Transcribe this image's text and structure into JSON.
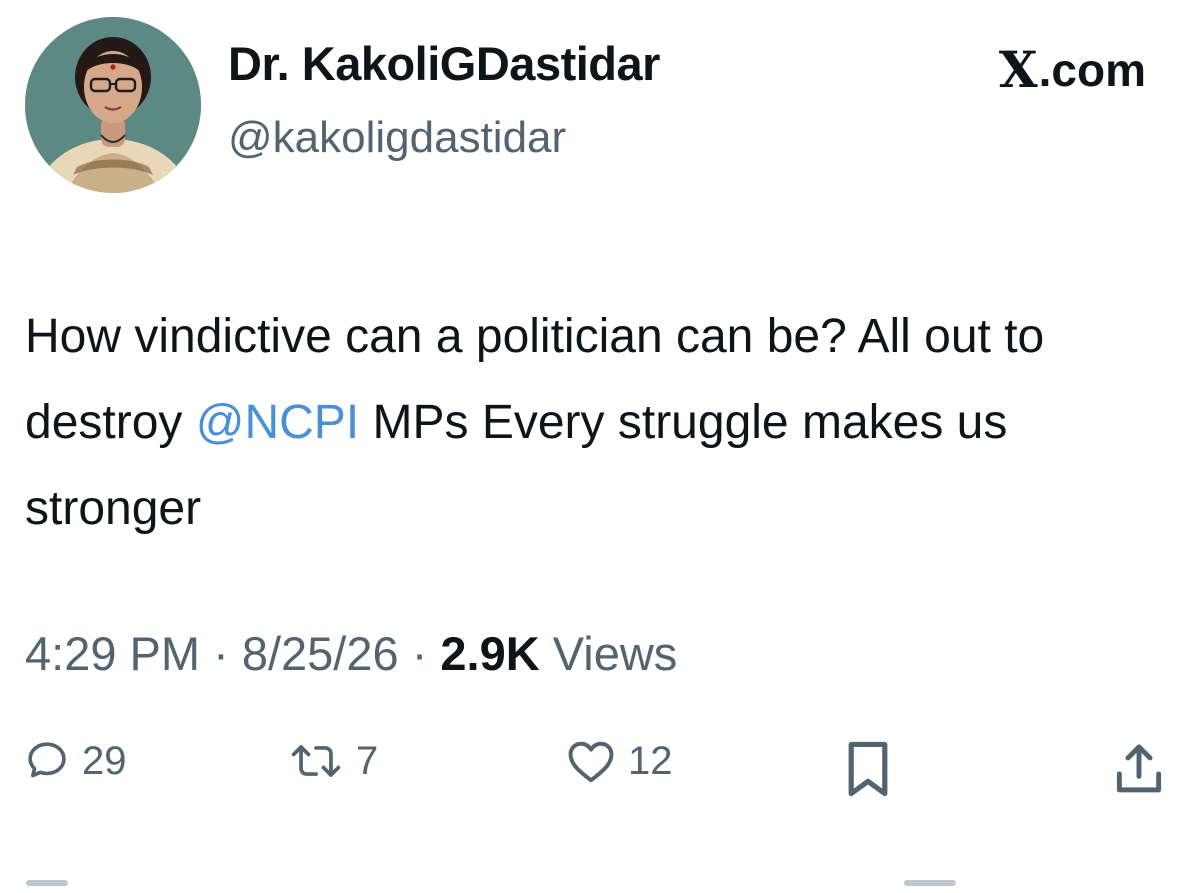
{
  "author": {
    "display_name": "Dr. KakoliGDastidar",
    "handle": "@kakoligdastidar",
    "avatar_icon": "profile-photo"
  },
  "source": {
    "logo": "X",
    "label": ".com"
  },
  "tweet": {
    "text_part1": "How vindictive can a politician can be? All out to destroy ",
    "mention": "@NCPI",
    "text_part2": " MPs Every struggle makes us stronger"
  },
  "meta": {
    "time": "4:29 PM",
    "sep1": " · ",
    "date": "8/25/26",
    "sep2": " · ",
    "views_count": "2.9K",
    "views_label": " Views"
  },
  "actions": {
    "replies": "29",
    "reposts": "7",
    "likes": "12"
  },
  "icons": {
    "reply": "speech-bubble-icon",
    "repost": "repost-arrows-icon",
    "like": "heart-icon",
    "bookmark": "bookmark-icon",
    "share": "share-icon"
  },
  "colors": {
    "text": "#0f1419",
    "secondary": "#536471",
    "link": "#4a90d6",
    "background": "#ffffff"
  }
}
